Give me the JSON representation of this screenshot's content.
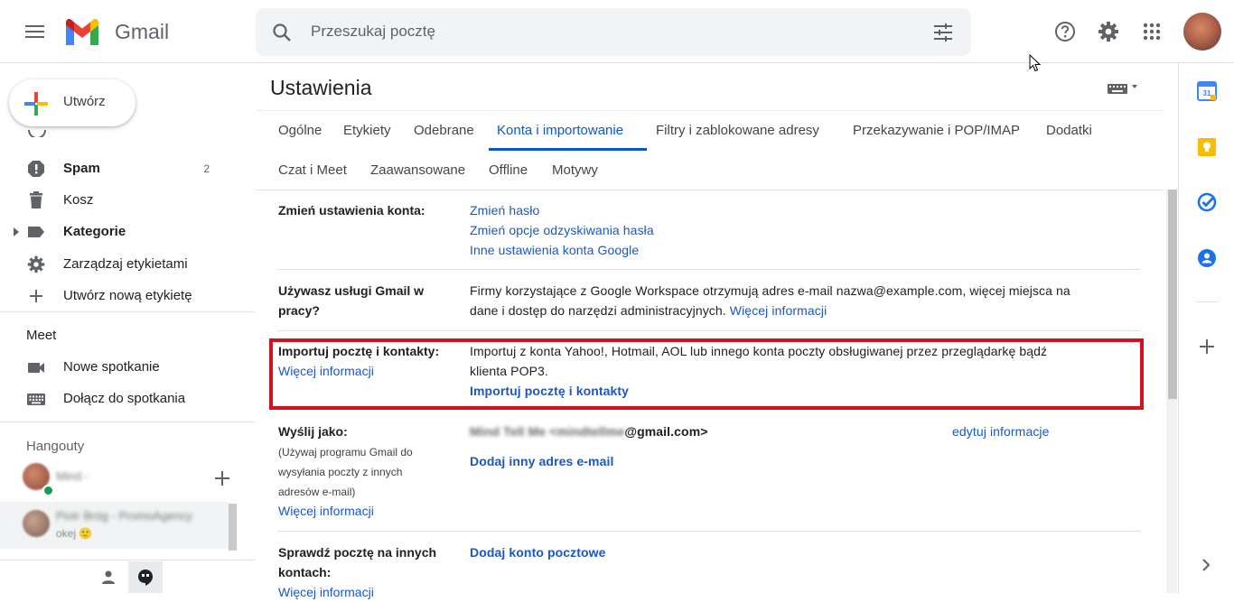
{
  "app": {
    "name": "Gmail"
  },
  "search": {
    "placeholder": "Przeszukaj pocztę"
  },
  "compose": {
    "label": "Utwórz"
  },
  "nav": {
    "items": [
      {
        "label": "Spam",
        "count": "2",
        "icon": "spam-icon",
        "bold": true
      },
      {
        "label": "Kosz",
        "count": "",
        "icon": "trash-icon",
        "bold": false
      },
      {
        "label": "Kategorie",
        "count": "",
        "icon": "label-icon",
        "bold": true
      },
      {
        "label": "Zarządzaj etykietami",
        "count": "",
        "icon": "gear-icon",
        "bold": false
      },
      {
        "label": "Utwórz nową etykietę",
        "count": "",
        "icon": "plus-icon",
        "bold": false
      }
    ]
  },
  "meet": {
    "title": "Meet",
    "items": [
      {
        "label": "Nowe spotkanie",
        "icon": "video-icon"
      },
      {
        "label": "Dołącz do spotkania",
        "icon": "keyboard-icon"
      }
    ]
  },
  "hangouts": {
    "title": "Hangouty",
    "contacts": [
      {
        "name": "Mind -",
        "status": ""
      },
      {
        "name": "Piotr Bróg - PromoAgency",
        "status": "okej 🙂"
      }
    ]
  },
  "settings": {
    "title": "Ustawienia",
    "tabs_row1": [
      "Ogólne",
      "Etykiety",
      "Odebrane",
      "Konta i importowanie",
      "Filtry i zablokowane adresy",
      "Przekazywanie i POP/IMAP",
      "Dodatki"
    ],
    "tabs_row2": [
      "Czat i Meet",
      "Zaawansowane",
      "Offline",
      "Motywy"
    ],
    "active_tab": "Konta i importowanie",
    "rows": {
      "change_account": {
        "label": "Zmień ustawienia konta:",
        "links": [
          "Zmień hasło",
          "Zmień opcje odzyskiwania hasła",
          "Inne ustawienia konta Google"
        ]
      },
      "workspace": {
        "label_line1": "Używasz usługi Gmail w",
        "label_line2": "pracy?",
        "text_line1": "Firmy korzystające z Google Workspace otrzymują adres e-mail nazwa@example.com, więcej miejsca na",
        "text_line2": "dane i dostęp do narzędzi administracyjnych.",
        "link": "Więcej informacji"
      },
      "import": {
        "label": "Importuj pocztę i kontakty:",
        "label_link": "Więcej informacji",
        "text_line1": "Importuj z konta Yahoo!, Hotmail, AOL lub innego konta poczty obsługiwanej przez przeglądarkę bądź",
        "text_line2": "klienta POP3.",
        "action": "Importuj pocztę i kontakty"
      },
      "send_as": {
        "label": "Wyślij jako:",
        "sub_line1": "(Używaj programu Gmail do",
        "sub_line2": "wysyłania poczty z innych",
        "sub_line3": "adresów e-mail)",
        "label_link": "Więcej informacji",
        "address_blurred": "Mind Tell Me <mindtellme",
        "address_domain": "@gmail.com>",
        "edit_link": "edytuj informacje",
        "add_link": "Dodaj inny adres e-mail"
      },
      "check_mail": {
        "label_line1": "Sprawdź pocztę na innych",
        "label_line2": "kontach:",
        "label_link": "Więcej informacji",
        "action": "Dodaj konto pocztowe"
      }
    }
  },
  "colors": {
    "accent_blue": "#0b57d0",
    "link_blue": "#1a57c8",
    "highlight_red": "#d6101e"
  }
}
